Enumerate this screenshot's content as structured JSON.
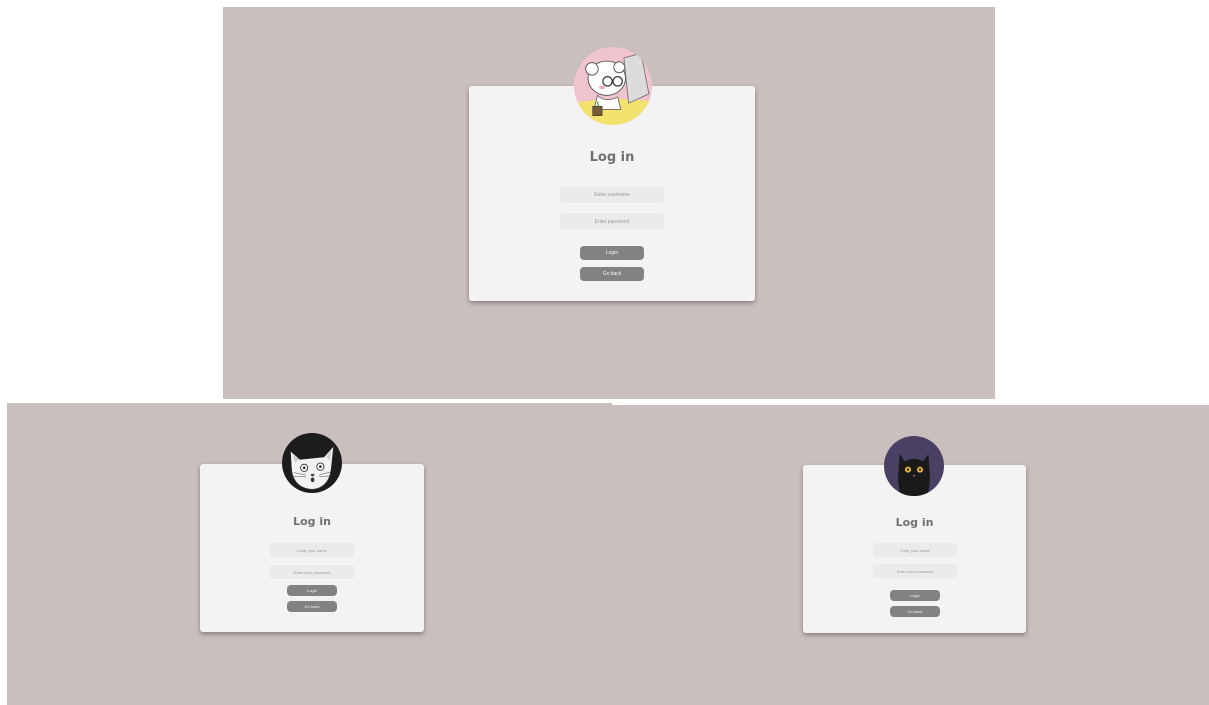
{
  "colors": {
    "background": "#c9bfbd",
    "card": "#f3f3f3",
    "title_text": "#707070",
    "field_bg": "#ebebeb",
    "button_bg": "#828282"
  },
  "screens": {
    "top": {
      "avatar_icon": "girl-at-laptop-avatar-icon",
      "title": "Log in",
      "username_placeholder": "Enter username",
      "password_placeholder": "Enter password",
      "login_label": "Login",
      "back_label": "Go back"
    },
    "left": {
      "avatar_icon": "surprised-white-cat-avatar-icon",
      "title": "Log in",
      "username_placeholder": "Enter your name",
      "password_placeholder": "Enter your password",
      "login_label": "Login",
      "back_label": "Go back"
    },
    "right": {
      "avatar_icon": "black-cat-avatar-icon",
      "title": "Log in",
      "username_placeholder": "Enter your name",
      "password_placeholder": "Enter your password",
      "login_label": "Login",
      "back_label": "Go back"
    }
  }
}
